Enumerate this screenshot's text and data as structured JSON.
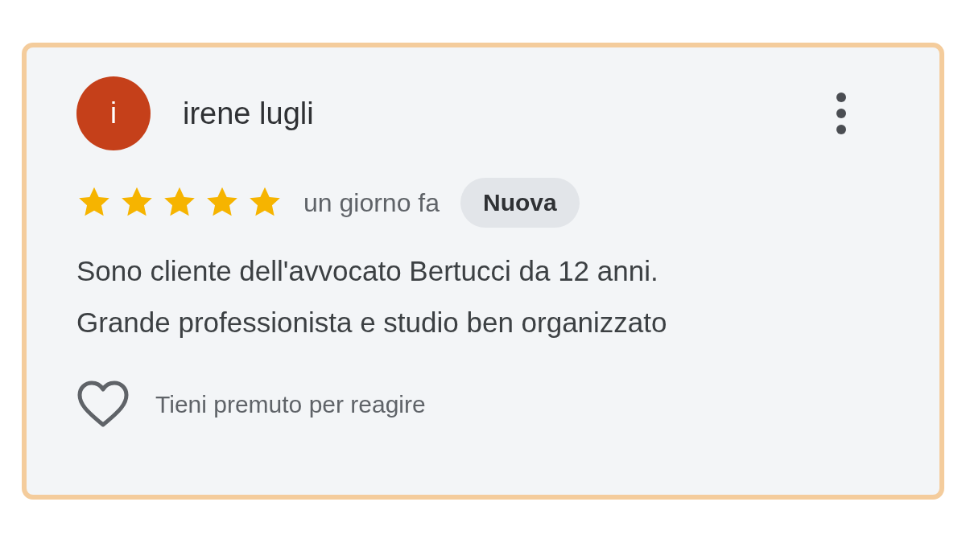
{
  "review": {
    "avatar_letter": "i",
    "author": "irene lugli",
    "stars": 5,
    "time": "un giorno fa",
    "badge": "Nuova",
    "text_lines": [
      "Sono cliente dell'avvocato Bertucci da 12 anni.",
      "Grande professionista e studio ben organizzato"
    ],
    "reaction_hint": "Tieni premuto per reagire"
  }
}
